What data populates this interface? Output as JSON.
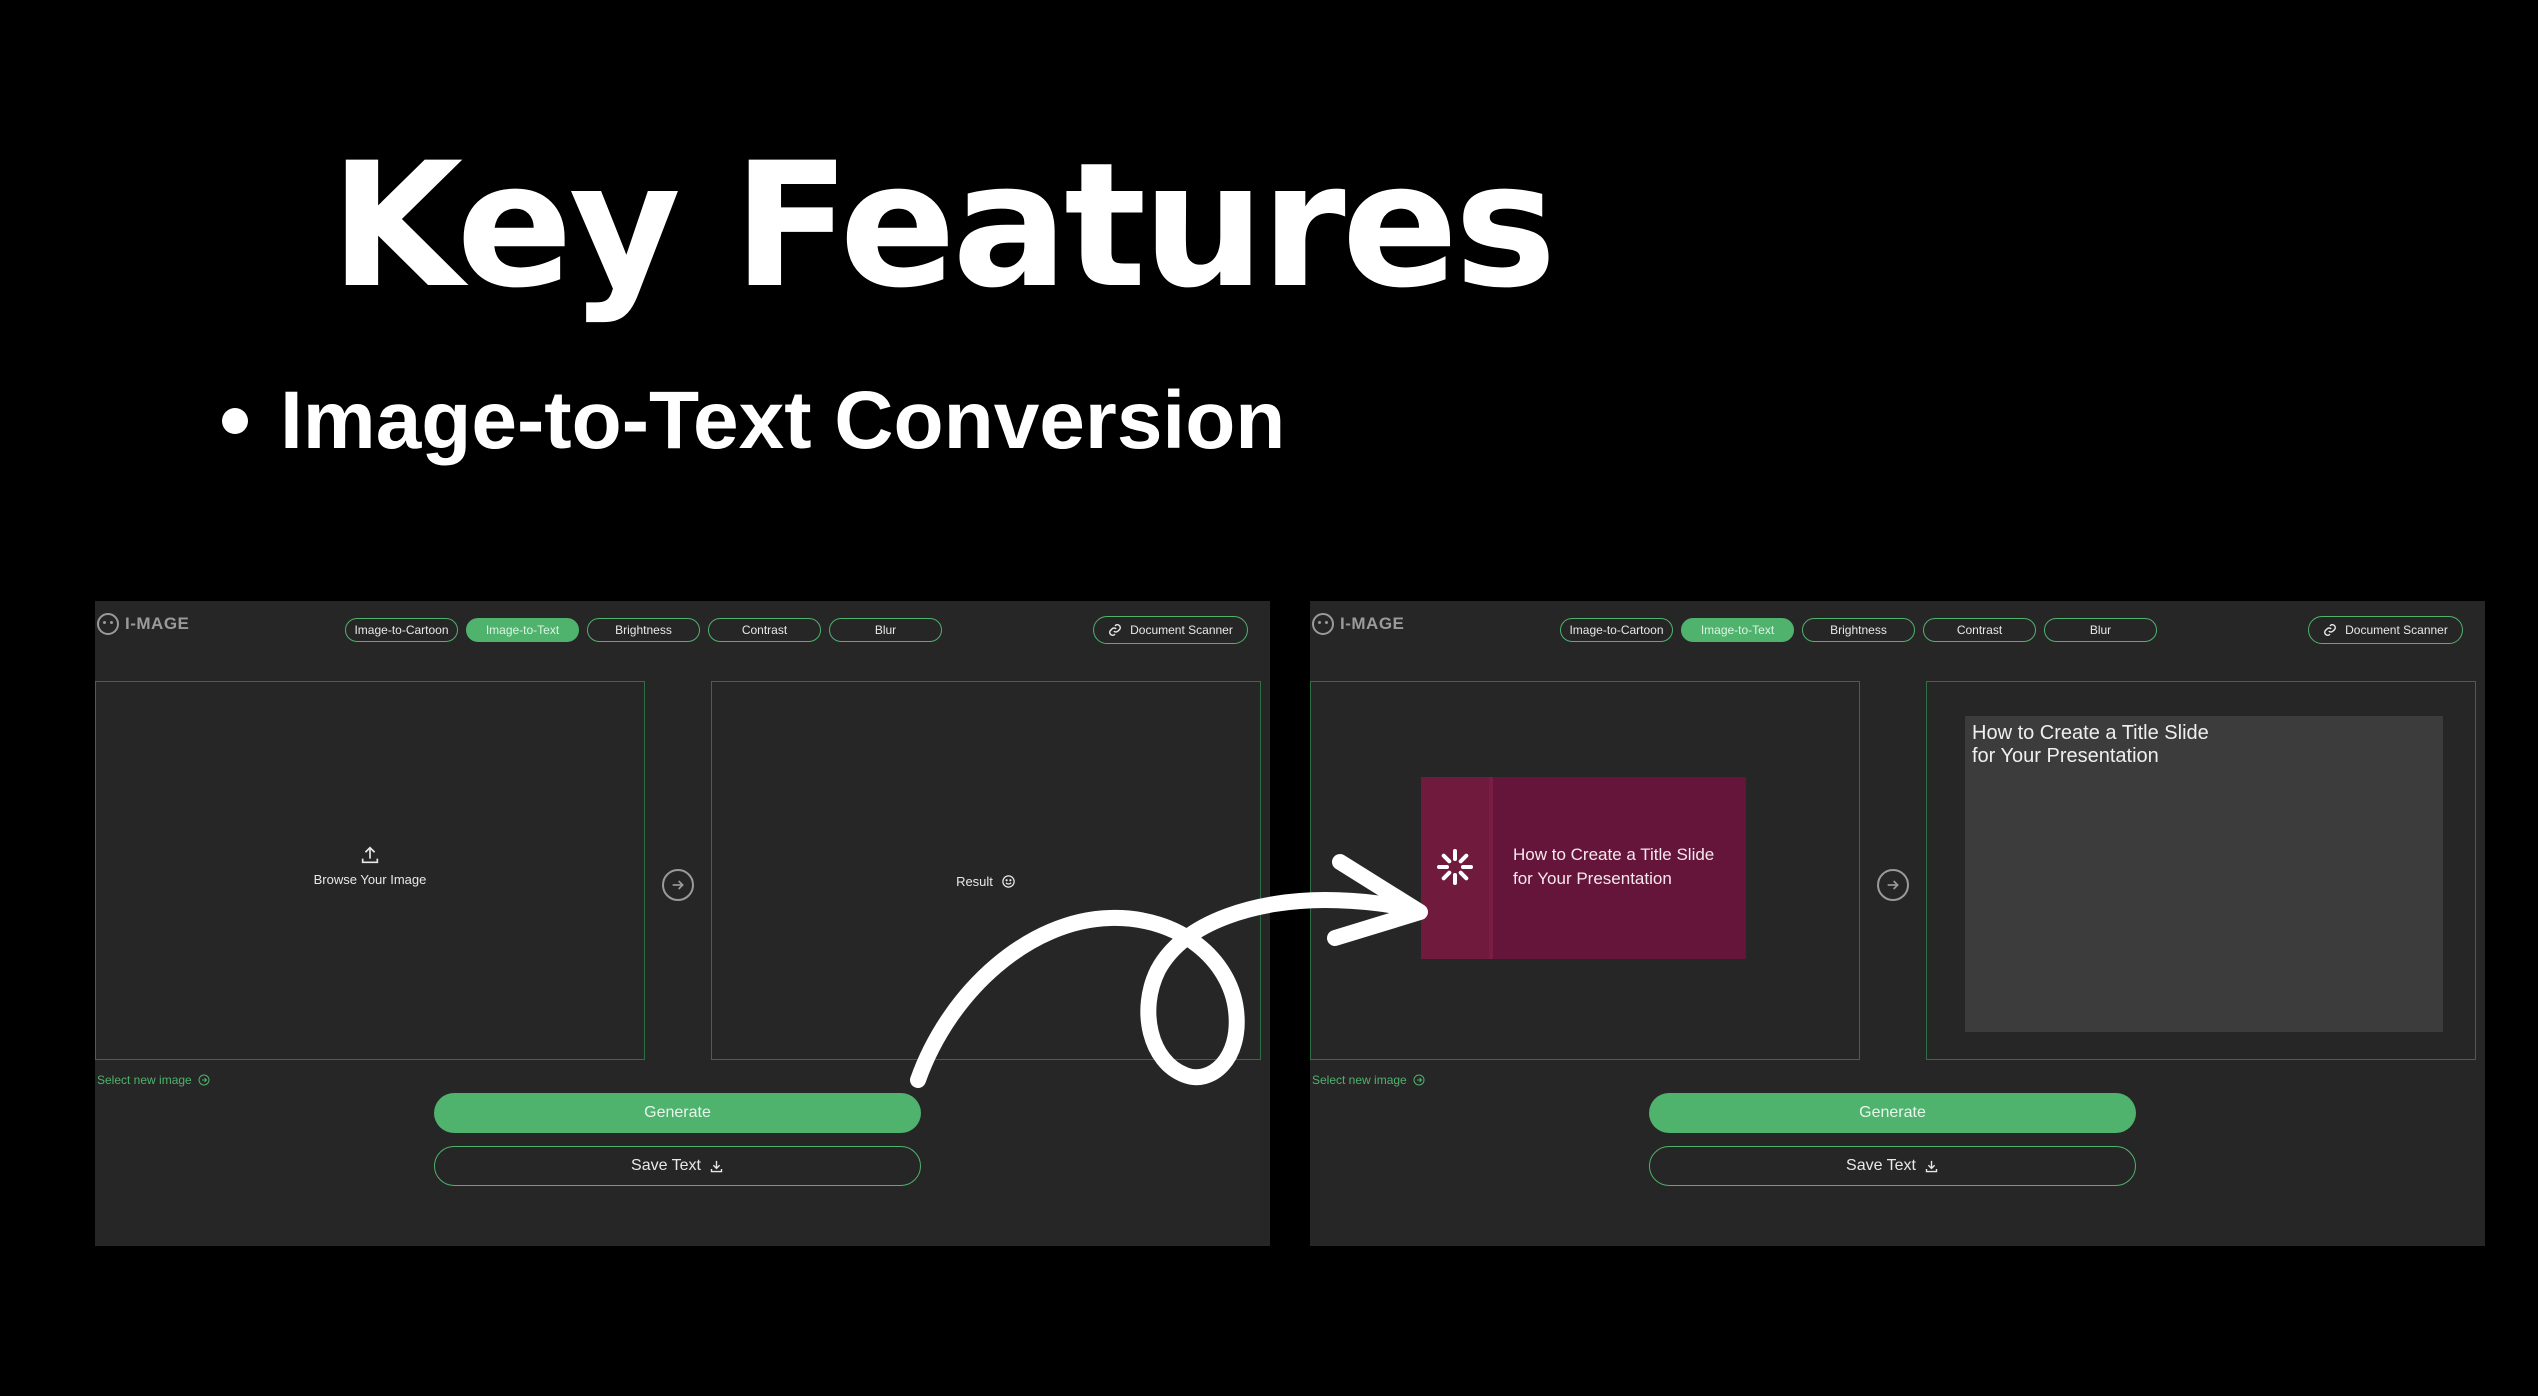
{
  "slide": {
    "title": "Key Features",
    "bullet": "Image-to-Text Conversion"
  },
  "app": {
    "logo_text": "I-MAGE",
    "tabs": [
      {
        "label": "Image-to-Cartoon",
        "active": false
      },
      {
        "label": "Image-to-Text",
        "active": true
      },
      {
        "label": "Brightness",
        "active": false
      },
      {
        "label": "Contrast",
        "active": false
      },
      {
        "label": "Blur",
        "active": false
      }
    ],
    "document_scanner_label": "Document Scanner",
    "browse_label": "Browse Your Image",
    "result_label": "Result",
    "select_new_label": "Select new image",
    "generate_label": "Generate",
    "save_label": "Save Text",
    "thumbnail_line1": "How to Create a Title Slide",
    "thumbnail_line2": "for Your Presentation",
    "result_line1": "How to Create a Title Slide",
    "result_line2": "for Your Presentation"
  },
  "colors": {
    "accent": "#4fb26d",
    "panel_border": "#2f6f46",
    "app_bg": "#262626",
    "thumbnail_bg": "#65153a"
  },
  "icons": [
    "upload-icon",
    "smile-icon",
    "arrow-right-circle-icon",
    "link-icon",
    "download-icon",
    "spinner-icon",
    "logo-icon"
  ]
}
